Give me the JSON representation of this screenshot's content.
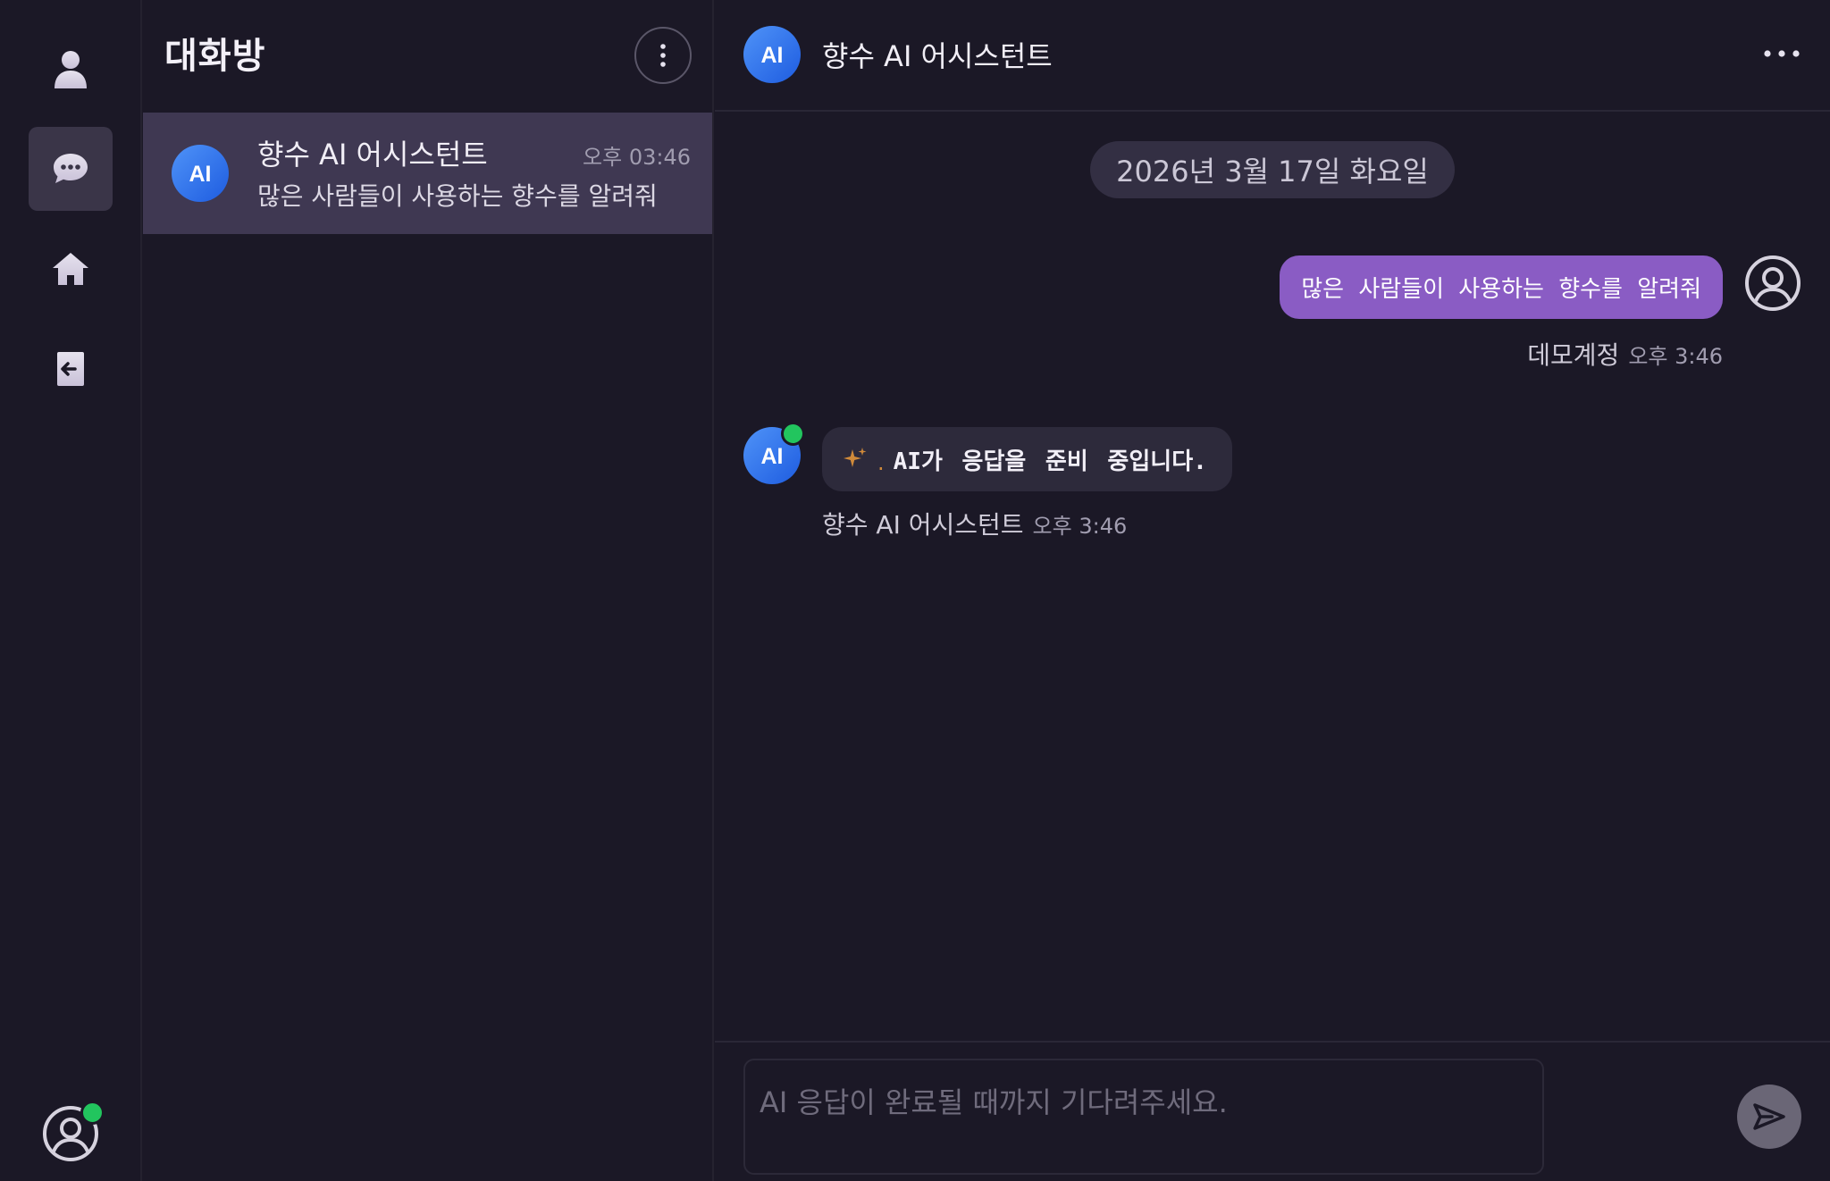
{
  "rail": {
    "items": [
      {
        "id": "profile",
        "icon": "user-icon"
      },
      {
        "id": "chats",
        "icon": "chat-bubble-icon",
        "active": true
      },
      {
        "id": "home",
        "icon": "home-icon"
      },
      {
        "id": "logout",
        "icon": "logout-icon"
      }
    ],
    "account_online": true
  },
  "conversation_list": {
    "title": "대화방",
    "items": [
      {
        "avatar_text": "AI",
        "name": "향수 AI 어시스턴트",
        "time": "오후 03:46",
        "preview": "많은 사람들이 사용하는 향수를 알려줘",
        "selected": true
      }
    ]
  },
  "chat": {
    "header": {
      "avatar_text": "AI",
      "title": "향수 AI 어시스턴트"
    },
    "date_divider": "2026년 3월 17일 화요일",
    "messages": [
      {
        "from": "user",
        "text": "많은 사람들이 사용하는 향수를 알려줘",
        "sender": "데모계정",
        "time": "오후 3:46"
      },
      {
        "from": "assistant",
        "avatar_text": "AI",
        "text": "AI가 응답을 준비 중입니다.",
        "typing_dot": ".",
        "sender": "향수 AI 어시스턴트",
        "time": "오후 3:46",
        "online": true
      }
    ],
    "composer": {
      "placeholder": "AI 응답이 완료될 때까지 기다려주세요.",
      "value": ""
    }
  },
  "colors": {
    "background": "#1b1826",
    "selected_item": "#3f3852",
    "user_bubble": "#8a5cc4",
    "assistant_bubble": "#2d2a3b",
    "date_pill": "#332f43",
    "online": "#22c55e",
    "avatar_gradient_start": "#3b82f6",
    "avatar_gradient_end": "#1d4ed8",
    "sparkle": "#d08a3a"
  }
}
